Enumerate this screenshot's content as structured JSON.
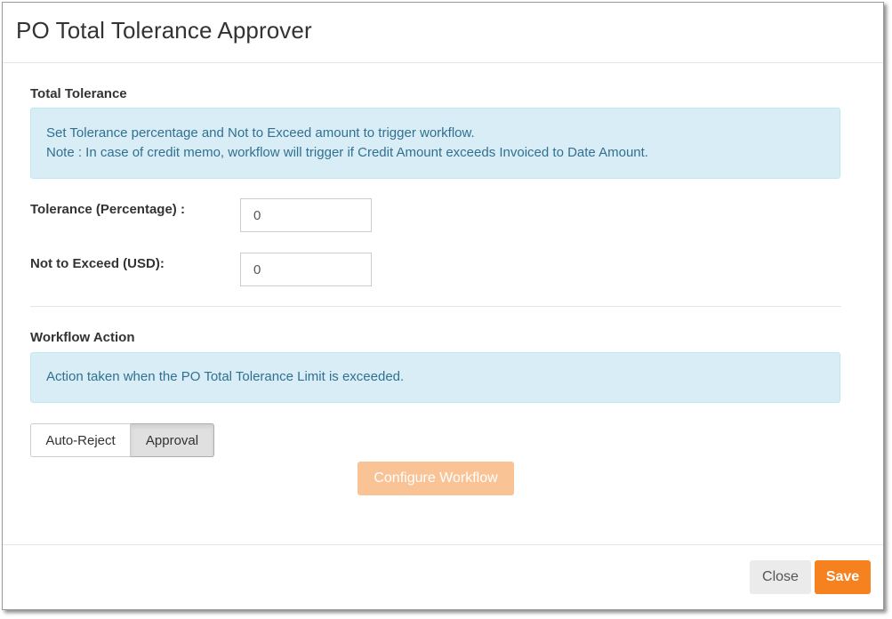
{
  "modal": {
    "title": "PO Total Tolerance Approver"
  },
  "total_tolerance": {
    "section_title": "Total Tolerance",
    "info_line_1": "Set Tolerance percentage and Not to Exceed amount to trigger workflow.",
    "info_line_2": "Note : In case of credit memo, workflow will trigger if Credit Amount exceeds Invoiced to Date Amount.",
    "tolerance_label": "Tolerance (Percentage) :",
    "tolerance_value": "0",
    "not_to_exceed_label": "Not to Exceed (USD):",
    "not_to_exceed_value": "0"
  },
  "workflow_action": {
    "section_title": "Workflow Action",
    "info_line": "Action taken when the PO Total Tolerance Limit is exceeded.",
    "options": [
      "Auto-Reject",
      "Approval"
    ],
    "selected": "Approval",
    "configure_label": "Configure Workflow"
  },
  "footer": {
    "close_label": "Close",
    "save_label": "Save"
  },
  "colors": {
    "info_background": "#d9edf7",
    "info_text": "#31708f",
    "save_accent": "#f5811f",
    "configure_disabled": "#f9c396"
  }
}
